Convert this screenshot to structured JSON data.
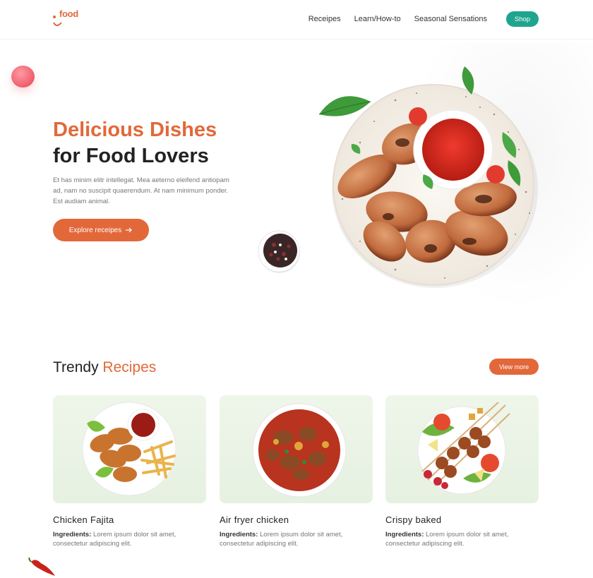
{
  "header": {
    "logo_text": "food",
    "nav": [
      "Receipes",
      "Learn/How-to",
      "Seasonal Sensations"
    ],
    "shop_label": "Shop"
  },
  "hero": {
    "title_line1": "Delicious Dishes",
    "title_line2": "for Food Lovers",
    "description": "Et has minim elitr intellegat. Mea aeterno eleifend antiopam ad, nam no suscipit quaerendum. At nam minimum ponder. Est audiam animal.",
    "cta_label": "Explore receipes",
    "cta_icon": "arrow-right-icon"
  },
  "trendy": {
    "title_main": "Trendy ",
    "title_accent": "Recipes",
    "view_more_label": "View more",
    "cards": [
      {
        "title": "Chicken Fajita",
        "desc_label": "Ingredients:",
        "desc_text": " Lorem ipsum dolor sit amet, consectetur adipiscing elit."
      },
      {
        "title": "Air fryer chicken",
        "desc_label": "Ingredients:",
        "desc_text": " Lorem ipsum dolor sit amet, consectetur adipiscing elit."
      },
      {
        "title": "Crispy baked",
        "desc_label": "Ingredients:",
        "desc_text": " Lorem ipsum dolor sit amet, consectetur adipiscing elit."
      }
    ]
  },
  "colors": {
    "accent": "#e2683a",
    "shop_green": "#1fa58f",
    "card_bg": "#eef6ea"
  }
}
